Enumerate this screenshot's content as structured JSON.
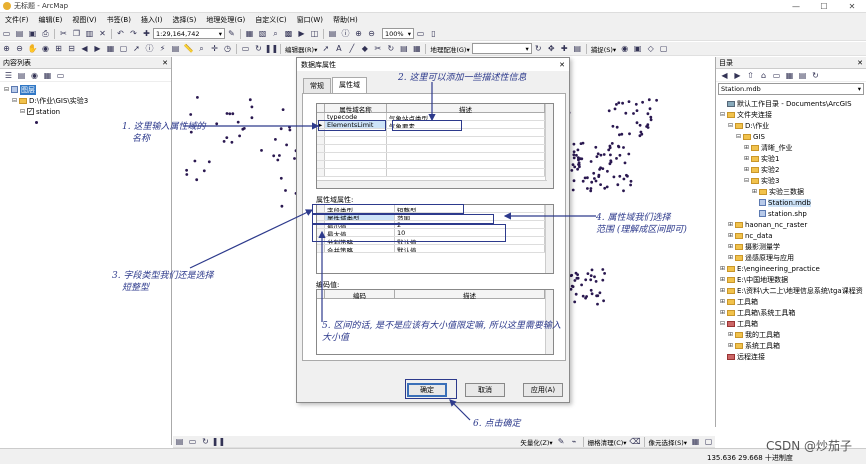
{
  "window": {
    "title": "无标题 - ArcMap",
    "min": "—",
    "max": "☐",
    "close": "✕"
  },
  "menu": [
    "文件(F)",
    "编辑(E)",
    "视图(V)",
    "书签(B)",
    "插入(I)",
    "选择(S)",
    "地理处理(G)",
    "自定义(C)",
    "窗口(W)",
    "帮助(H)"
  ],
  "toolbar": {
    "scale": "1:29,164,742",
    "zoom_pct": "100%",
    "editor": "编辑器(R)▾",
    "georef": "地理配准(G)▾",
    "snap": "捕捉(S)▾",
    "vectorize": "矢量化(Z)▾",
    "raster_clean": "栅格清理(C)▾",
    "cell_select": "像元选择(S)▾"
  },
  "toc": {
    "title": "内容列表",
    "layers_label": "图层",
    "folder": "D:\\作业\\GIS\\实验3",
    "layer": "station"
  },
  "catalog": {
    "title": "目录",
    "location": "Station.mdb",
    "items": [
      {
        "text": "默认工作目录 - Documents\\ArcGIS",
        "indent": 0,
        "icon": "home"
      },
      {
        "text": "文件夹连接",
        "indent": 0,
        "icon": "folder",
        "exp": "⊟"
      },
      {
        "text": "D:\\作业",
        "indent": 1,
        "icon": "folder",
        "exp": "⊟"
      },
      {
        "text": "GIS",
        "indent": 2,
        "icon": "folder",
        "exp": "⊟"
      },
      {
        "text": "清晰_作业",
        "indent": 3,
        "icon": "folder",
        "exp": "⊞"
      },
      {
        "text": "实验1",
        "indent": 3,
        "icon": "folder",
        "exp": "⊞"
      },
      {
        "text": "实验2",
        "indent": 3,
        "icon": "folder",
        "exp": "⊞"
      },
      {
        "text": "实验3",
        "indent": 3,
        "icon": "folder",
        "exp": "⊟"
      },
      {
        "text": "实验三数据",
        "indent": 4,
        "icon": "folder",
        "exp": "⊞"
      },
      {
        "text": "Station.mdb",
        "indent": 4,
        "icon": "db",
        "exp": ""
      },
      {
        "text": "station.shp",
        "indent": 4,
        "icon": "db",
        "exp": ""
      },
      {
        "text": "haonan_nc_raster",
        "indent": 1,
        "icon": "folder",
        "exp": "⊞"
      },
      {
        "text": "nc_data",
        "indent": 1,
        "icon": "folder",
        "exp": "⊞"
      },
      {
        "text": "摄影测量学",
        "indent": 1,
        "icon": "folder",
        "exp": "⊞"
      },
      {
        "text": "遥感原理与应用",
        "indent": 1,
        "icon": "folder",
        "exp": "⊞"
      },
      {
        "text": "E:\\engineering_practice",
        "indent": 0,
        "icon": "folder",
        "exp": "⊞"
      },
      {
        "text": "E:\\中国地理数据",
        "indent": 0,
        "icon": "folder",
        "exp": "⊞"
      },
      {
        "text": "E:\\资料\\大二上\\地理信息系统\\tga课程资",
        "indent": 0,
        "icon": "folder",
        "exp": "⊞"
      },
      {
        "text": "工具箱",
        "indent": 0,
        "icon": "folder",
        "exp": "⊞"
      },
      {
        "text": "工具箱\\系统工具箱",
        "indent": 0,
        "icon": "folder",
        "exp": "⊞"
      },
      {
        "text": "工具箱",
        "indent": 0,
        "icon": "box",
        "exp": "⊟"
      },
      {
        "text": "我的工具箱",
        "indent": 1,
        "icon": "folder",
        "exp": "⊞"
      },
      {
        "text": "系统工具箱",
        "indent": 1,
        "icon": "folder",
        "exp": "⊞"
      },
      {
        "text": "远程连接",
        "indent": 0,
        "icon": "box",
        "exp": ""
      }
    ]
  },
  "dialog": {
    "title": "数据库属性",
    "close": "✕",
    "tabs": [
      "常规",
      "属性域"
    ],
    "domain_header": [
      "属性域名称",
      "描述"
    ],
    "domain_rows": [
      [
        "typecode",
        "气象站点类型"
      ],
      [
        "ElementsLimit",
        "气象要素"
      ]
    ],
    "props_label": "属性域属性:",
    "props_rows": [
      [
        "字段类型",
        "短整型"
      ],
      [
        "属性域类型",
        "范围"
      ],
      [
        "最小值",
        "2"
      ],
      [
        "最大值",
        "10"
      ],
      [
        "分割策略",
        "默认值"
      ],
      [
        "合并策略",
        "默认值"
      ]
    ],
    "coded_label": "编码值:",
    "coded_header": [
      "编码",
      "描述"
    ],
    "ok": "确定",
    "cancel": "取消",
    "apply": "应用(A)"
  },
  "annotations": {
    "a1": [
      "1. 这里输入属性域的",
      "名称"
    ],
    "a2": "2. 这里可以添加一些描述性信息",
    "a3": [
      "3. 字段类型我们还是选择",
      "短整型"
    ],
    "a4": [
      "4. 属性域我们选择",
      "范围 (理解成区间即可)"
    ],
    "a5": [
      "5. 区间的话, 是不是应该有大小值限定嘛, 所以这里需要输入",
      "大小值"
    ],
    "a6": "6. 点击确定"
  },
  "status": {
    "coords": "135.636  29.668 十进制度"
  },
  "watermark": "CSDN @炒茄子",
  "colors": {
    "annotation": "#2d3a8c",
    "points": "#2a1850",
    "highlight": "#cde3f8"
  }
}
